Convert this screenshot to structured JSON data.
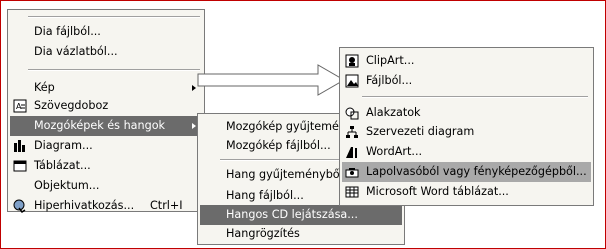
{
  "menu1": {
    "items": [
      {
        "label": "Dia fájlból..."
      },
      {
        "label": "Dia vázlatból..."
      },
      {
        "label": "Kép"
      },
      {
        "label": "Szövegdoboz"
      },
      {
        "label": "Mozgóképek és hangok"
      },
      {
        "label": "Diagram..."
      },
      {
        "label": "Táblázat..."
      },
      {
        "label": "Objektum..."
      },
      {
        "label": "Hiperhivatkozás...",
        "shortcut": "Ctrl+I"
      }
    ]
  },
  "menu2": {
    "items": [
      {
        "label": "Mozgókép gyűjteményből..."
      },
      {
        "label": "Mozgókép fájlból..."
      },
      {
        "label": "Hang gyűjteményből..."
      },
      {
        "label": "Hang fájlból..."
      },
      {
        "label": "Hangos CD lejátszása..."
      },
      {
        "label": "Hangrögzítés"
      }
    ]
  },
  "menu3": {
    "items": [
      {
        "label": "ClipArt..."
      },
      {
        "label": "Fájlból..."
      },
      {
        "label": "Alakzatok"
      },
      {
        "label": "Szervezeti diagram"
      },
      {
        "label": "WordArt..."
      },
      {
        "label": "Lapolvasóból vagy fényképezőgépből..."
      },
      {
        "label": "Microsoft Word táblázat..."
      }
    ]
  },
  "colors": {
    "highlight": "#a9a9a9",
    "highlight_dark": "#6b6b6b",
    "frame": "#c00000"
  },
  "icons": [
    "text-box-icon",
    "diagram-icon",
    "table-icon",
    "hyperlink-icon",
    "clipart-icon",
    "picture-icon",
    "shapes-icon",
    "org-chart-icon",
    "wordart-icon",
    "scanner-icon",
    "word-table-icon",
    "arrow-connector-icon"
  ]
}
